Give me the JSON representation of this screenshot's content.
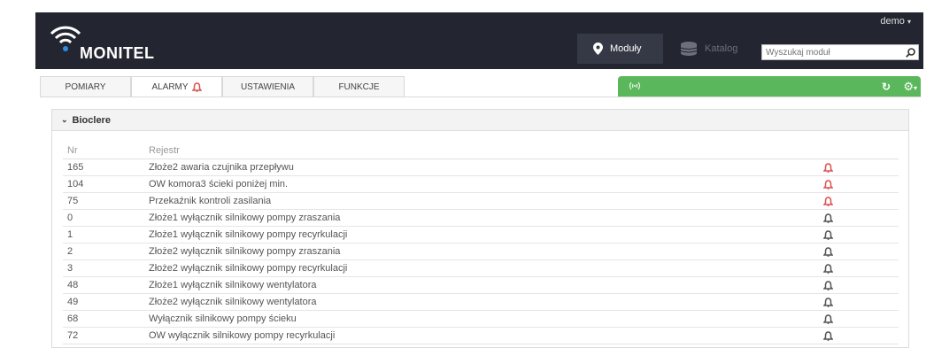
{
  "header": {
    "brand": "MONITEL",
    "user": "demo",
    "nav": {
      "moduly": "Moduły",
      "katalog": "Katalog"
    },
    "search": {
      "placeholder": "Wyszukaj moduł"
    }
  },
  "tabs": [
    {
      "label": "POMIARY"
    },
    {
      "label": "ALARMY"
    },
    {
      "label": "USTAWIENIA"
    },
    {
      "label": "FUNKCJE"
    }
  ],
  "colors": {
    "topbar": "#232630",
    "status_ok": "#5bb75b",
    "alarm_active": "#d9534f",
    "alarm_inactive": "#555555"
  },
  "panel": {
    "title": "Bioclere",
    "columns": {
      "nr": "Nr",
      "rejestr": "Rejestr"
    },
    "rows": [
      {
        "nr": "165",
        "rejestr": "Złoże2 awaria czujnika przepływu",
        "alarm_active": true
      },
      {
        "nr": "104",
        "rejestr": "OW komora3 ścieki poniżej min.",
        "alarm_active": true
      },
      {
        "nr": "75",
        "rejestr": "Przekaźnik kontroli zasilania",
        "alarm_active": true
      },
      {
        "nr": "0",
        "rejestr": "Złoże1 wyłącznik silnikowy pompy zraszania",
        "alarm_active": false
      },
      {
        "nr": "1",
        "rejestr": "Złoże1 wyłącznik silnikowy pompy recyrkulacji",
        "alarm_active": false
      },
      {
        "nr": "2",
        "rejestr": "Złoże2 wyłącznik silnikowy pompy zraszania",
        "alarm_active": false
      },
      {
        "nr": "3",
        "rejestr": "Złoże2 wyłącznik silnikowy pompy recyrkulacji",
        "alarm_active": false
      },
      {
        "nr": "48",
        "rejestr": "Złoże1 wyłącznik silnikowy wentylatora",
        "alarm_active": false
      },
      {
        "nr": "49",
        "rejestr": "Złoże2 wyłącznik silnikowy wentylatora",
        "alarm_active": false
      },
      {
        "nr": "68",
        "rejestr": "Wyłącznik silnikowy pompy ścieku",
        "alarm_active": false
      },
      {
        "nr": "72",
        "rejestr": "OW wyłącznik silnikowy pompy recyrkulacji",
        "alarm_active": false
      }
    ]
  }
}
